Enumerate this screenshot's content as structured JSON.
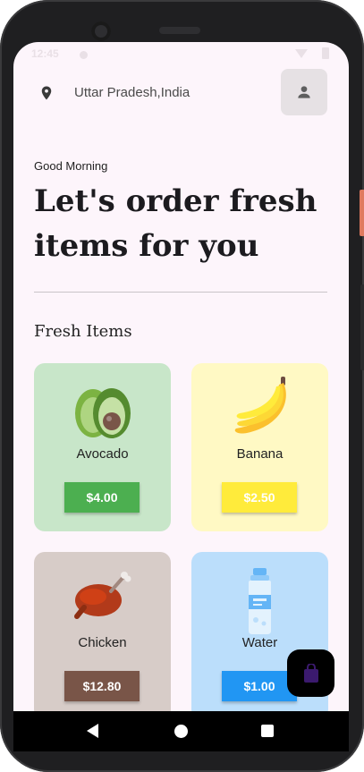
{
  "status_bar": {
    "time": "12:45"
  },
  "header": {
    "location": "Uttar Pradesh,India",
    "location_icon": "location-pin-icon",
    "profile_icon": "person-icon"
  },
  "hero": {
    "greeting": "Good Morning",
    "headline": "Let's order fresh items for you"
  },
  "section": {
    "title": "Fresh Items"
  },
  "items": [
    {
      "name": "Avocado",
      "price": "$4.00",
      "icon": "avocado-icon",
      "card_color": "#c8e6c9",
      "button_color": "#4caf50"
    },
    {
      "name": "Banana",
      "price": "$2.50",
      "icon": "banana-icon",
      "card_color": "#fff9c4",
      "button_color": "#ffeb3b"
    },
    {
      "name": "Chicken",
      "price": "$12.80",
      "icon": "chicken-icon",
      "card_color": "#d7ccc8",
      "button_color": "#795548"
    },
    {
      "name": "Water",
      "price": "$1.00",
      "icon": "water-bottle-icon",
      "card_color": "#bbdefb",
      "button_color": "#2196f3"
    }
  ],
  "fab": {
    "icon": "shopping-bag-icon"
  },
  "nav": {
    "back_icon": "back-icon",
    "home_icon": "home-icon",
    "recents_icon": "recents-icon"
  }
}
